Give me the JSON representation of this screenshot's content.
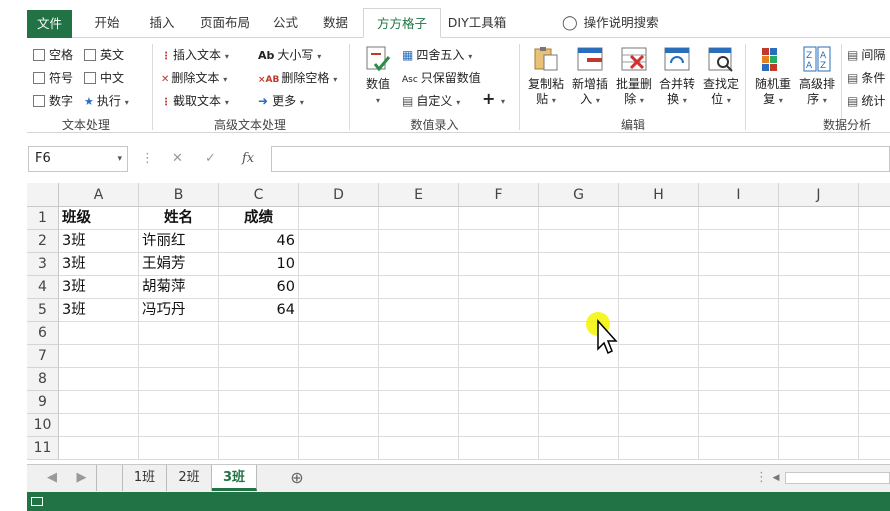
{
  "tabs": [
    "文件",
    "开始",
    "插入",
    "页面布局",
    "公式",
    "数据",
    "方方格子",
    "DIY工具箱"
  ],
  "tell_me": "操作说明搜索",
  "ribbon": {
    "text_group": {
      "items": [
        "空格",
        "英文",
        "符号",
        "中文",
        "数字",
        "执行"
      ],
      "label": "文本处理"
    },
    "adv_group": {
      "items": [
        "插入文本",
        "删除文本",
        "截取文本",
        "大小写",
        "删除空格",
        "更多"
      ],
      "label": "高级文本处理"
    },
    "value_group": {
      "big": "数值",
      "items": [
        "四舍五入",
        "只保留数值",
        "自定义"
      ],
      "plus": "+",
      "label": "数值录入"
    },
    "edit_group": {
      "buttons": [
        [
          "复制粘",
          "贴"
        ],
        [
          "新增插",
          "入"
        ],
        [
          "批量删",
          "除"
        ],
        [
          "合并转",
          "换"
        ],
        [
          "查找定",
          "位"
        ]
      ],
      "label": "编辑"
    },
    "analysis_group": {
      "buttons": [
        [
          "随机重",
          "复"
        ],
        [
          "高级排",
          "序"
        ]
      ],
      "items": [
        "间隔",
        "条件",
        "统计"
      ],
      "label": "数据分析"
    }
  },
  "formula_bar": {
    "name_box": "F6",
    "fx": "fx",
    "value": ""
  },
  "columns": [
    "A",
    "B",
    "C",
    "D",
    "E",
    "F",
    "G",
    "H",
    "I",
    "J"
  ],
  "rows": [
    "1",
    "2",
    "3",
    "4",
    "5",
    "6",
    "7",
    "8",
    "9",
    "10",
    "11"
  ],
  "table": {
    "headers": [
      "班级",
      "姓名",
      "成绩"
    ],
    "rows": [
      [
        "3班",
        "许丽红",
        "46"
      ],
      [
        "3班",
        "王娟芳",
        "10"
      ],
      [
        "3班",
        "胡菊萍",
        "60"
      ],
      [
        "3班",
        "冯巧丹",
        "64"
      ]
    ]
  },
  "sheets": [
    "1班",
    "2班",
    "3班"
  ],
  "active_sheet": "3班",
  "colors": {
    "accent": "#217346",
    "cursor_highlight": "#f5f500"
  }
}
